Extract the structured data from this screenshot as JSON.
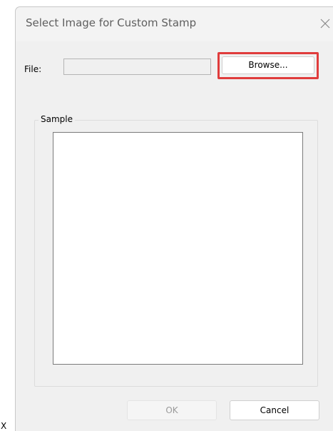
{
  "dialog": {
    "title": "Select Image for Custom Stamp",
    "close_icon": "close-icon"
  },
  "file": {
    "label": "File:",
    "value": "",
    "browse_label": "Browse..."
  },
  "sample": {
    "legend": "Sample"
  },
  "buttons": {
    "ok_label": "OK",
    "cancel_label": "Cancel"
  },
  "corner_text": "X",
  "colors": {
    "highlight": "#e03c3c",
    "dialog_background": "#f0f0f0"
  }
}
